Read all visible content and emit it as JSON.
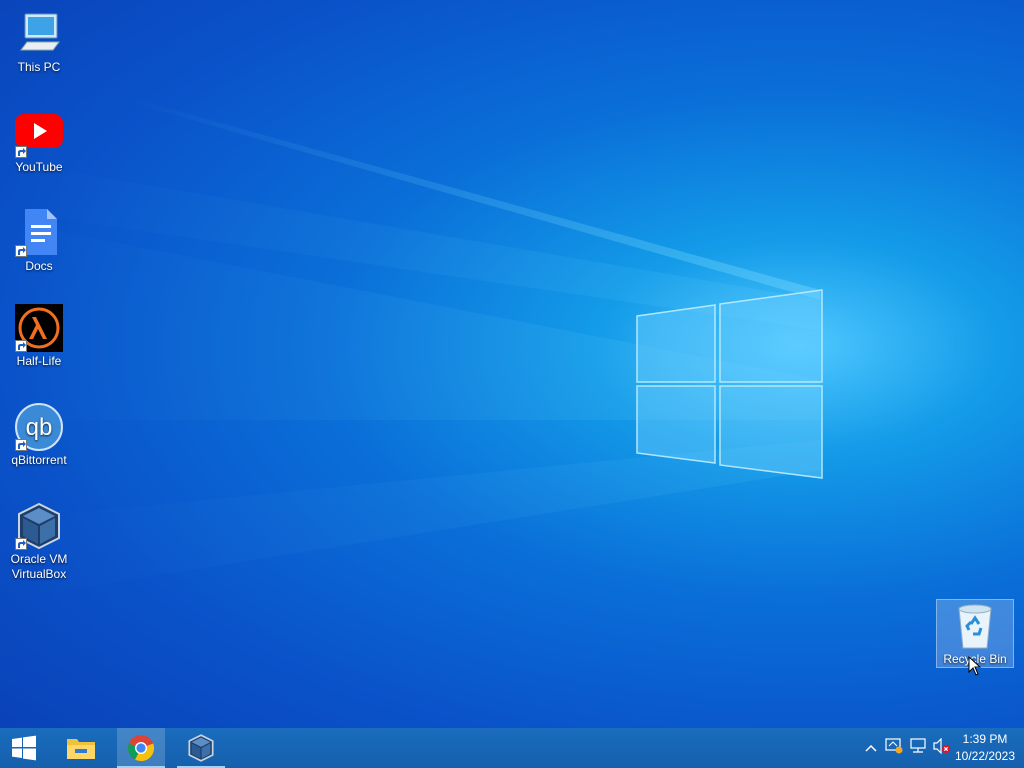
{
  "desktop": {
    "icons": [
      {
        "label": "This PC",
        "icon": "monitor-icon"
      },
      {
        "label": "YouTube",
        "icon": "youtube-icon"
      },
      {
        "label": "Docs",
        "icon": "docs-icon"
      },
      {
        "label": "Half-Life",
        "icon": "half-life-icon"
      },
      {
        "label": "qBittorrent",
        "icon": "qbittorrent-icon"
      },
      {
        "label_line1": "Oracle VM",
        "label_line2": "VirtualBox",
        "icon": "virtualbox-icon"
      },
      {
        "label": "Recycle Bin",
        "icon": "recycle-bin-icon"
      }
    ]
  },
  "taskbar": {
    "apps": [
      {
        "name": "Start",
        "icon": "windows-start-icon"
      },
      {
        "name": "File Explorer",
        "icon": "folder-icon"
      },
      {
        "name": "Google Chrome",
        "icon": "chrome-icon"
      },
      {
        "name": "VirtualBox",
        "icon": "virtualbox-icon"
      }
    ],
    "tray": {
      "icons": [
        "chevron-up-icon",
        "network-warning-icon",
        "network-icon",
        "volume-muted-icon"
      ],
      "time": "1:39 PM",
      "date": "10/22/2023"
    }
  },
  "colors": {
    "accent": "#0a6fd8",
    "taskbar": "#1565b4"
  }
}
